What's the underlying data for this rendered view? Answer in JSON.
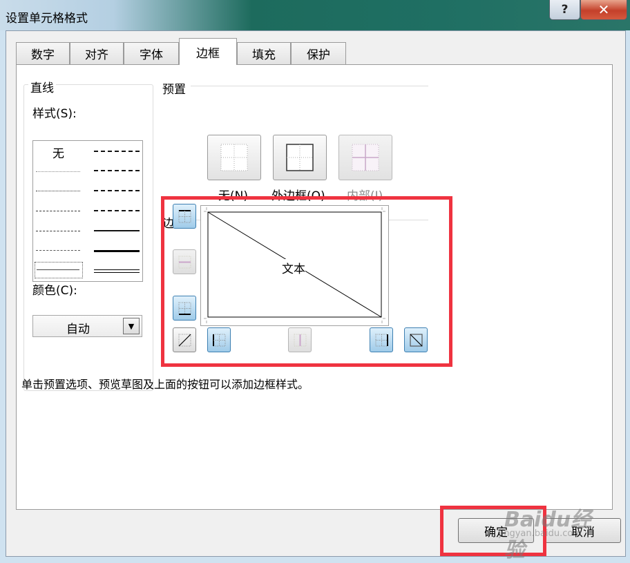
{
  "window": {
    "title": "设置单元格格式",
    "help_label": "?",
    "close_label": "✕"
  },
  "tabs": [
    {
      "label": "数字",
      "active": false
    },
    {
      "label": "对齐",
      "active": false
    },
    {
      "label": "字体",
      "active": false
    },
    {
      "label": "边框",
      "active": true
    },
    {
      "label": "填充",
      "active": false
    },
    {
      "label": "保护",
      "active": false
    }
  ],
  "line": {
    "group_label": "直线",
    "style_label": "样式(S):",
    "none_label": "无",
    "color_label": "颜色(C):",
    "color_value": "自动"
  },
  "preset": {
    "group_label": "预置",
    "buttons": [
      {
        "label": "无(N)",
        "enabled": true
      },
      {
        "label": "外边框(O)",
        "enabled": true
      },
      {
        "label": "内部(I)",
        "enabled": false
      }
    ]
  },
  "border": {
    "group_label": "边框",
    "preview_text": "文本",
    "diagonal_down": true,
    "outline": true
  },
  "hint": "单击预置选项、预览草图及上面的按钮可以添加边框样式。",
  "buttons": {
    "ok": "确定",
    "cancel": "取消"
  },
  "watermark": {
    "brand": "Baidu经验",
    "url": "jingyan.baidu.com"
  },
  "colors": {
    "highlight": "#ef3340",
    "button_on": "#9fcbe9",
    "title_bg": "#1f6f63"
  }
}
